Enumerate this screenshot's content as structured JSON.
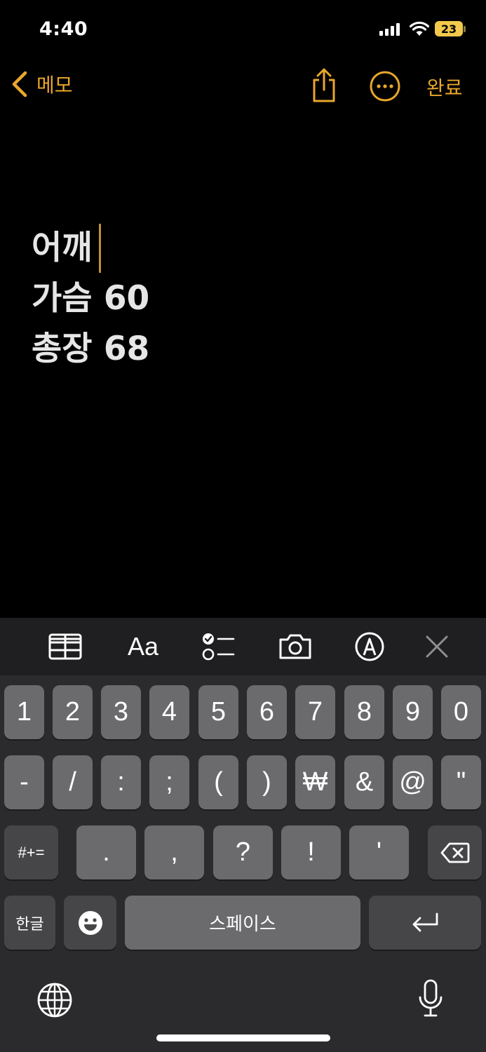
{
  "status": {
    "time": "4:40",
    "battery": "23"
  },
  "nav": {
    "back_label": "메모",
    "done_label": "완료"
  },
  "note": {
    "lines": [
      "어깨",
      "가슴 60",
      "총장 68"
    ]
  },
  "toolbar": {
    "format_label": "Aa"
  },
  "keyboard": {
    "row1": [
      "1",
      "2",
      "3",
      "4",
      "5",
      "6",
      "7",
      "8",
      "9",
      "0"
    ],
    "row2": [
      "-",
      "/",
      ":",
      ";",
      "(",
      ")",
      "₩",
      "&",
      "@",
      "\""
    ],
    "row3": [
      ".",
      ",",
      "?",
      "!",
      "'"
    ],
    "symbols_label": "#+=",
    "hangul_label": "한글",
    "space_label": "스페이스"
  },
  "colors": {
    "accent": "#e9a72a",
    "background": "#000000",
    "keyboard_bg": "#2b2b2d",
    "key": "#6b6b6d"
  },
  "icons": [
    "chevron-left-icon",
    "share-icon",
    "more-icon",
    "table-icon",
    "checklist-icon",
    "camera-icon",
    "markup-icon",
    "close-icon",
    "backspace-icon",
    "emoji-icon",
    "return-icon",
    "globe-icon",
    "mic-icon"
  ]
}
